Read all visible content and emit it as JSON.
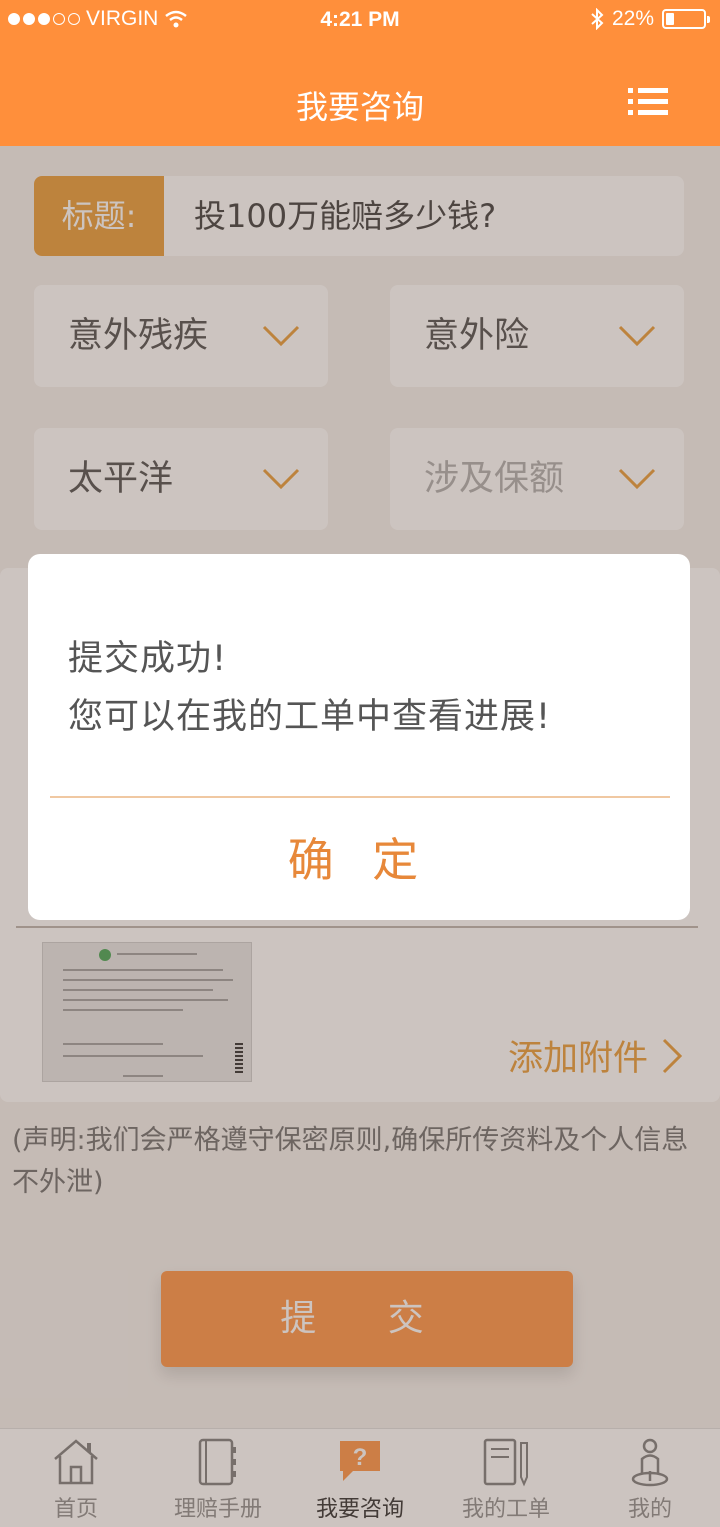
{
  "status_bar": {
    "carrier": "VIRGIN",
    "time": "4:21 PM",
    "battery_label": "22%",
    "battery_level": 0.22
  },
  "header": {
    "title": "我要咨询"
  },
  "form": {
    "title_label": "标题:",
    "title_value": "投100万能赔多少钱?",
    "selects": [
      {
        "value": "意外残疾",
        "placeholder": false
      },
      {
        "value": "意外险",
        "placeholder": false
      },
      {
        "value": "太平洋",
        "placeholder": false
      },
      {
        "value": "涉及保额",
        "placeholder": true
      }
    ],
    "attach_label": "添加附件",
    "statement": "(声明:我们会严格遵守保密原则,确保所传资料及个人信息不外泄)",
    "submit_label": "提 交"
  },
  "dialog": {
    "line1": "提交成功!",
    "line2": "您可以在我的工单中查看进展!",
    "ok_label": "确 定"
  },
  "tabs": [
    {
      "label": "首页",
      "icon": "home-icon",
      "active": false
    },
    {
      "label": "理赔手册",
      "icon": "handbook-icon",
      "active": false
    },
    {
      "label": "我要咨询",
      "icon": "consult-icon",
      "active": true
    },
    {
      "label": "我的工单",
      "icon": "workorder-icon",
      "active": false
    },
    {
      "label": "我的",
      "icon": "profile-icon",
      "active": false
    }
  ],
  "colors": {
    "brand": "#ff8f3b",
    "accent": "#e7962d",
    "overlay": "rgba(120,100,90,0.38)"
  }
}
